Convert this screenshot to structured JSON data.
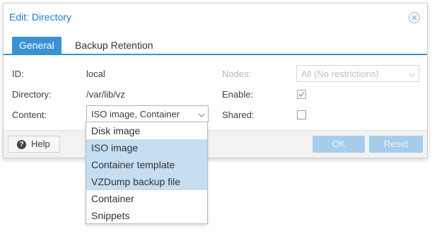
{
  "dialog": {
    "title": "Edit: Directory"
  },
  "tabs": [
    {
      "label": "General",
      "active": true
    },
    {
      "label": "Backup Retention",
      "active": false
    }
  ],
  "form": {
    "id_label": "ID:",
    "id_value": "local",
    "directory_label": "Directory:",
    "directory_value": "/var/lib/vz",
    "content_label": "Content:",
    "content_value": "ISO image, Container",
    "nodes_label": "Nodes:",
    "nodes_value": "All (No restrictions)",
    "enable_label": "Enable:",
    "enable_checked": true,
    "shared_label": "Shared:",
    "shared_checked": false
  },
  "footer": {
    "help_label": "Help",
    "ok_label": "OK",
    "reset_label": "Reset"
  },
  "content_options": [
    {
      "label": "Disk image",
      "selected": false
    },
    {
      "label": "ISO image",
      "selected": true
    },
    {
      "label": "Container template",
      "selected": true
    },
    {
      "label": "VZDump backup file",
      "selected": true
    },
    {
      "label": "Container",
      "selected": false
    },
    {
      "label": "Snippets",
      "selected": false
    }
  ],
  "colors": {
    "accent": "#3892d4",
    "title": "#157fcc",
    "selected_item": "#c5def2",
    "disabled_button": "#a8cdea"
  },
  "icons": {
    "close": "close-circle-icon",
    "help": "question-circle-icon",
    "dropdown": "chevron-down-icon",
    "check": "checkmark-icon"
  }
}
